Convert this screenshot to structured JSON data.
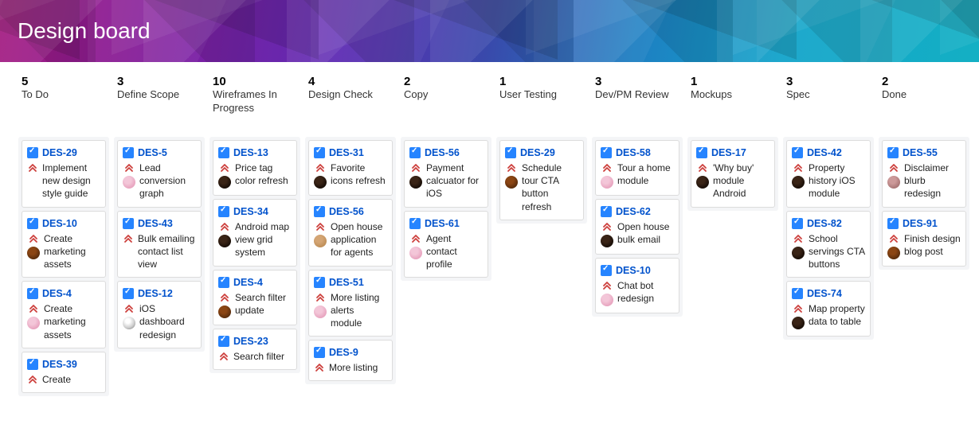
{
  "title": "Design board",
  "columns": [
    {
      "count": "5",
      "name": "To Do",
      "cards": [
        {
          "key": "DES-29",
          "summary": "Implement new design style guide",
          "avatar": null
        },
        {
          "key": "DES-10",
          "summary": "Create marketing assets",
          "avatar": "a1"
        },
        {
          "key": "DES-4",
          "summary": "Create marketing assets",
          "avatar": "a2"
        },
        {
          "key": "DES-39",
          "summary": "Create",
          "avatar": null
        }
      ]
    },
    {
      "count": "3",
      "name": "Define Scope",
      "cards": [
        {
          "key": "DES-5",
          "summary": "Lead conversion graph",
          "avatar": "a2"
        },
        {
          "key": "DES-43",
          "summary": "Bulk emailing contact list view",
          "avatar": null
        },
        {
          "key": "DES-12",
          "summary": "iOS dashboard redesign",
          "avatar": "a5"
        }
      ]
    },
    {
      "count": "10",
      "name": "Wireframes In Progress",
      "cards": [
        {
          "key": "DES-13",
          "summary": "Price tag color refresh",
          "avatar": "a3"
        },
        {
          "key": "DES-34",
          "summary": "Android map view grid system",
          "avatar": "a3"
        },
        {
          "key": "DES-4",
          "summary": "Search filter update",
          "avatar": "a1"
        },
        {
          "key": "DES-23",
          "summary": "Search filter",
          "avatar": null
        }
      ]
    },
    {
      "count": "4",
      "name": "Design Check",
      "cards": [
        {
          "key": "DES-31",
          "summary": "Favorite icons refresh",
          "avatar": "a3"
        },
        {
          "key": "DES-56",
          "summary": "Open house application for agents",
          "avatar": "a4"
        },
        {
          "key": "DES-51",
          "summary": "More listing alerts module",
          "avatar": "a2"
        },
        {
          "key": "DES-9",
          "summary": "More listing",
          "avatar": null
        }
      ]
    },
    {
      "count": "2",
      "name": "Copy",
      "cards": [
        {
          "key": "DES-56",
          "summary": "Payment calcuator for iOS",
          "avatar": "a3"
        },
        {
          "key": "DES-61",
          "summary": "Agent contact profile",
          "avatar": "a2"
        }
      ]
    },
    {
      "count": "1",
      "name": "User Testing",
      "cards": [
        {
          "key": "DES-29",
          "summary": "Schedule tour CTA button refresh",
          "avatar": "a1"
        }
      ]
    },
    {
      "count": "3",
      "name": "Dev/PM Review",
      "cards": [
        {
          "key": "DES-58",
          "summary": "Tour a home module",
          "avatar": "a2"
        },
        {
          "key": "DES-62",
          "summary": "Open house bulk email",
          "avatar": "a3"
        },
        {
          "key": "DES-10",
          "summary": "Chat bot redesign",
          "avatar": "a2"
        }
      ]
    },
    {
      "count": "1",
      "name": "Mockups",
      "cards": [
        {
          "key": "DES-17",
          "summary": "'Why buy' module Android",
          "avatar": "a3"
        }
      ]
    },
    {
      "count": "3",
      "name": "Spec",
      "cards": [
        {
          "key": "DES-42",
          "summary": "Property history iOS module",
          "avatar": "a3"
        },
        {
          "key": "DES-82",
          "summary": "School servings CTA buttons",
          "avatar": "a3"
        },
        {
          "key": "DES-74",
          "summary": "Map property data to table",
          "avatar": "a3"
        }
      ]
    },
    {
      "count": "2",
      "name": "Done",
      "cards": [
        {
          "key": "DES-55",
          "summary": "Disclaimer blurb redesign",
          "avatar": "a6"
        },
        {
          "key": "DES-91",
          "summary": "Finish design blog post",
          "avatar": "a1"
        }
      ]
    }
  ]
}
